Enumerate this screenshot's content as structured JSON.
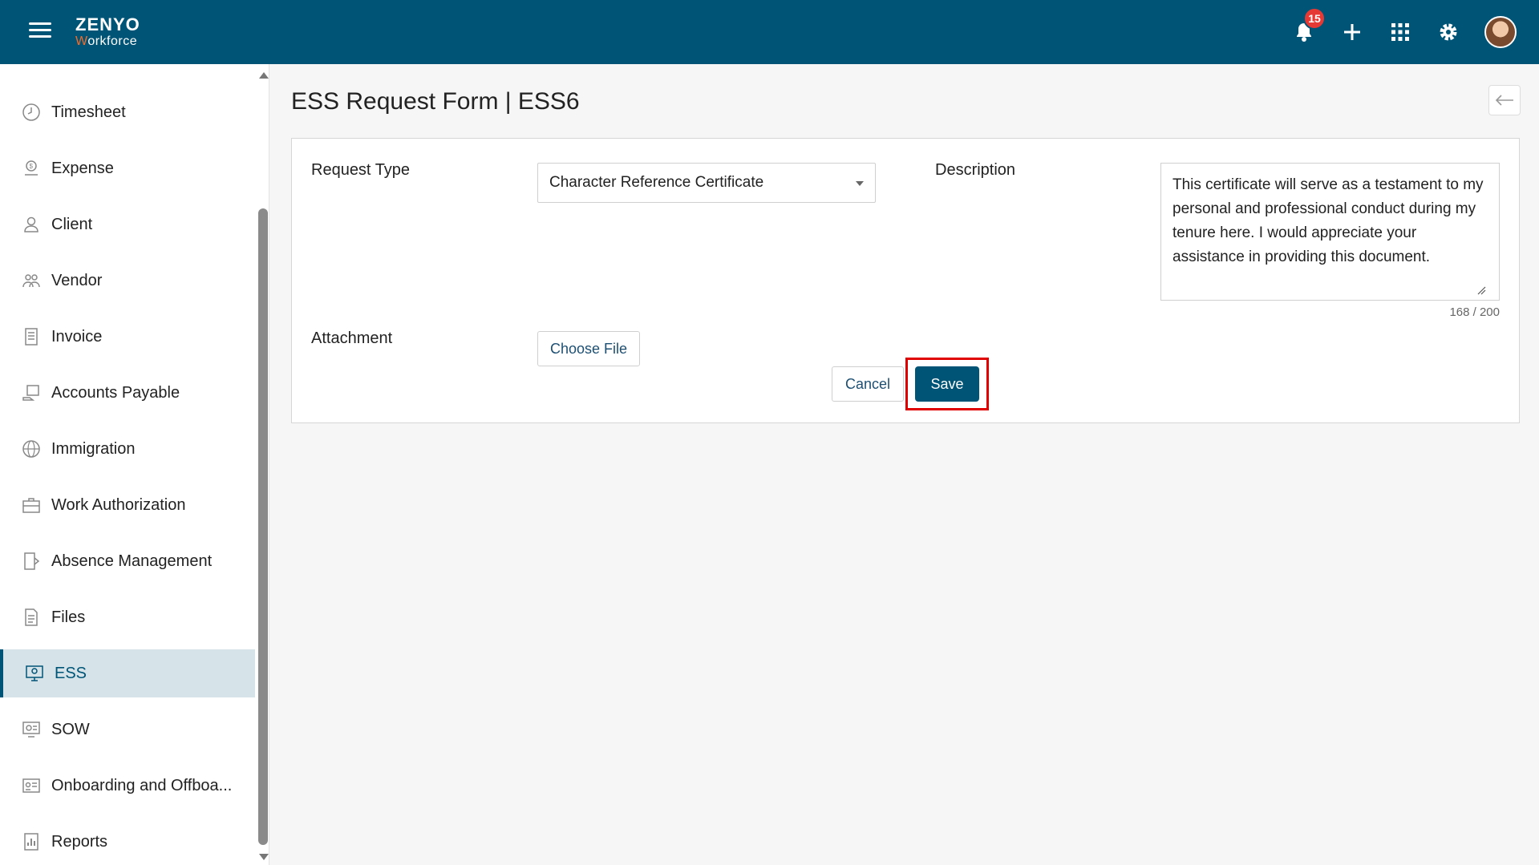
{
  "header": {
    "brand": "ZENYO",
    "brand_sub_first": "W",
    "brand_sub_rest": "orkforce",
    "notification_count": "15",
    "icons": [
      "menu-icon",
      "bell-icon",
      "plus-icon",
      "apps-grid-icon",
      "gear-icon",
      "avatar"
    ]
  },
  "sidebar": {
    "items": [
      {
        "label": "Timesheet",
        "icon": "clock-icon"
      },
      {
        "label": "Expense",
        "icon": "expense-icon"
      },
      {
        "label": "Client",
        "icon": "user-icon"
      },
      {
        "label": "Vendor",
        "icon": "vendor-icon"
      },
      {
        "label": "Invoice",
        "icon": "invoice-icon"
      },
      {
        "label": "Accounts Payable",
        "icon": "payable-icon"
      },
      {
        "label": "Immigration",
        "icon": "globe-icon"
      },
      {
        "label": "Work Authorization",
        "icon": "briefcase-icon"
      },
      {
        "label": "Absence Management",
        "icon": "door-icon"
      },
      {
        "label": "Files",
        "icon": "file-icon"
      },
      {
        "label": "ESS",
        "icon": "ess-icon",
        "active": true
      },
      {
        "label": "SOW",
        "icon": "sow-icon"
      },
      {
        "label": "Onboarding and Offboa...",
        "icon": "id-card-icon"
      },
      {
        "label": "Reports",
        "icon": "report-icon"
      }
    ]
  },
  "page": {
    "title": "ESS Request Form | ESS6"
  },
  "form": {
    "request_type_label": "Request Type",
    "request_type_value": "Character Reference Certificate",
    "description_label": "Description",
    "description_value": "This certificate will serve as a testament to my personal and professional conduct during my tenure here. I would appreciate your assistance in providing this document.",
    "char_count": "168 / 200",
    "attachment_label": "Attachment",
    "choose_file_label": "Choose File",
    "cancel_label": "Cancel",
    "save_label": "Save"
  },
  "colors": {
    "primary": "#005577",
    "highlight": "#e00000",
    "badge": "#e53935"
  }
}
